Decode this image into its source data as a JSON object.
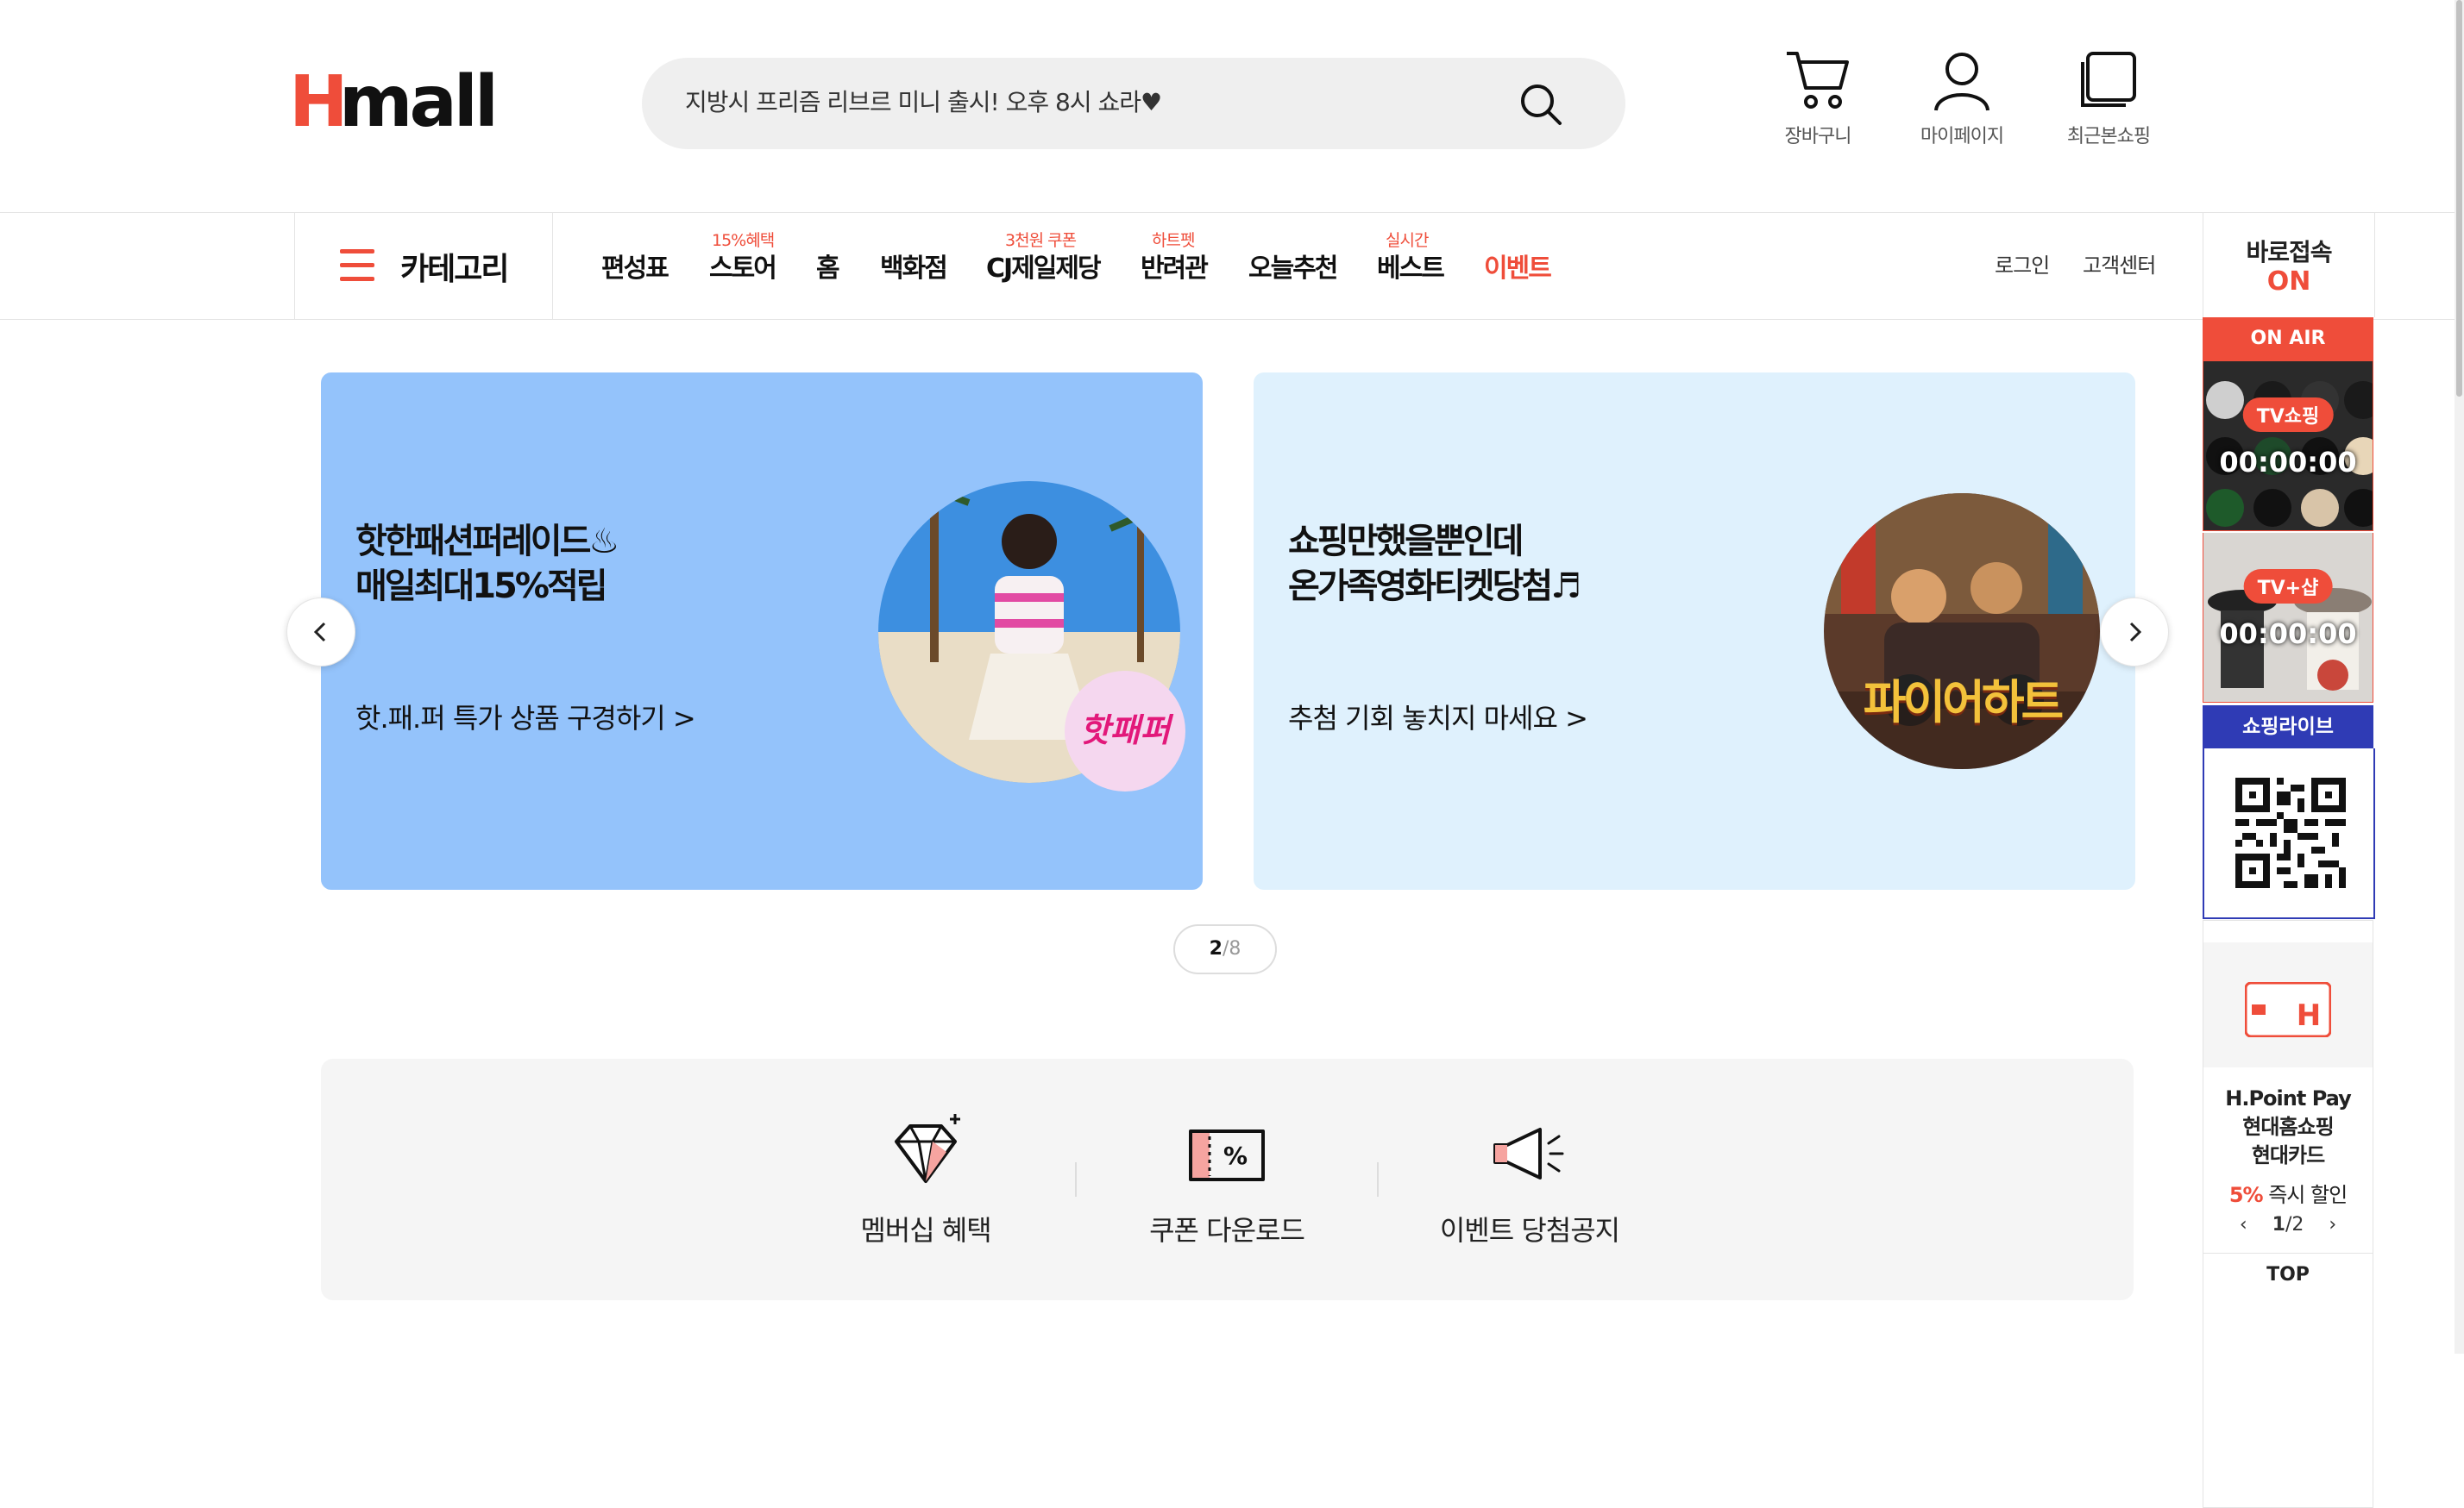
{
  "header": {
    "logo_text": "Hmall",
    "search_placeholder": "지방시 프리즘 리브르 미니 출시! 오후 8시 쇼라♥",
    "icons": [
      {
        "name": "cart-icon",
        "label": "장바구니"
      },
      {
        "name": "user-icon",
        "label": "마이페이지"
      },
      {
        "name": "recent-icon",
        "label": "최근본쇼핑"
      }
    ]
  },
  "nav": {
    "category_label": "카테고리",
    "items": [
      {
        "label": "편성표",
        "sub": ""
      },
      {
        "label": "스토어",
        "sub": "15%혜택"
      },
      {
        "label": "홈",
        "sub": ""
      },
      {
        "label": "백화점",
        "sub": ""
      },
      {
        "label": "CJ제일제당",
        "sub": "3천원 쿠폰"
      },
      {
        "label": "반려관",
        "sub": "하트펫"
      },
      {
        "label": "오늘추천",
        "sub": ""
      },
      {
        "label": "베스트",
        "sub": "실시간"
      },
      {
        "label": "이벤트",
        "sub": ""
      }
    ],
    "util": {
      "login": "로그인",
      "customer_center": "고객센터"
    }
  },
  "rail": {
    "head_line1": "바로접속",
    "head_line2": "ON",
    "on_air": "ON AIR",
    "tv_label": "TV쇼핑",
    "tv_time": "00:00:00",
    "tvplus_label": "TV+샵",
    "tvplus_time": "00:00:00",
    "shoplive": "쇼핑라이브",
    "hpoint_line1": "H.Point Pay",
    "hpoint_line2": "현대홈쇼핑",
    "hpoint_line3": "현대카드",
    "discount_pct": "5%",
    "discount_text": " 즉시 할인",
    "pager_current": "1",
    "pager_total": "2",
    "top": "TOP"
  },
  "banners": [
    {
      "title1": "핫한패션퍼레이드♨",
      "title2": "매일최대15%적립",
      "link": "핫.패.퍼 특가 상품 구경하기 >",
      "bg": "#94c3fb",
      "sticker": "핫패퍼"
    },
    {
      "title1": "쇼핑만했을뿐인데",
      "title2": "온가족영화티켓당첨♬",
      "link": "추첨 기회 놓치지 마세요 >",
      "bg": "#dff1fd",
      "poster_text": "파이어하트"
    }
  ],
  "banner_pager": {
    "current": "2",
    "total": "/8"
  },
  "quick_menu": [
    {
      "icon": "diamond-icon",
      "label": "멤버십 혜택"
    },
    {
      "icon": "coupon-icon",
      "label": "쿠폰 다운로드"
    },
    {
      "icon": "megaphone-icon",
      "label": "이벤트 당첨공지"
    }
  ],
  "colors": {
    "accent": "#ef4d3a",
    "shoplive": "#2f3bb5",
    "text": "#111111"
  }
}
